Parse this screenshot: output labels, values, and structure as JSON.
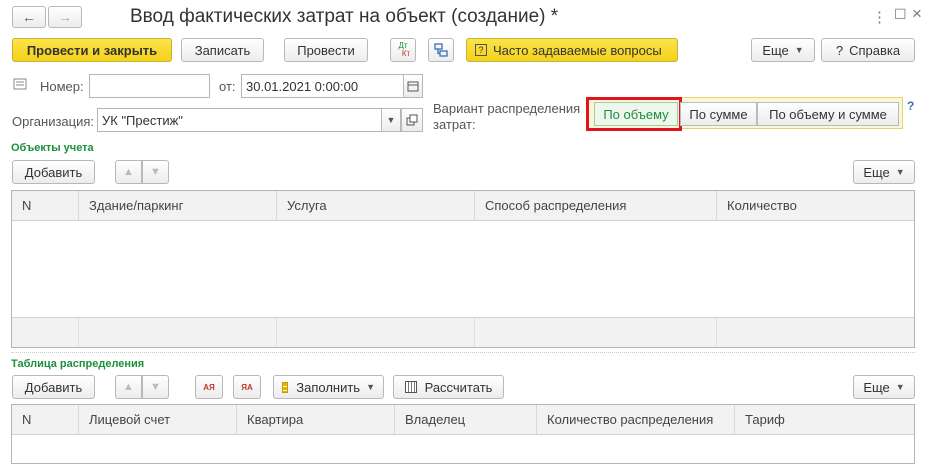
{
  "window": {
    "title": "Ввод фактических затрат на объект (создание) *",
    "back_icon": "←",
    "forward_icon": "→",
    "menu_icon": "⋮",
    "maximize_icon": "☐",
    "close_icon": "×"
  },
  "toolbar": {
    "post_close_label": "Провести и закрыть",
    "save_label": "Записать",
    "post_label": "Провести",
    "dt_kt_top": "Дт",
    "dt_kt_bottom": "Кт",
    "faq_label": "Часто задаваемые вопросы",
    "more_label": "Еще",
    "help_label": "Справка",
    "help_icon": "?"
  },
  "form": {
    "number_label": "Номер:",
    "number_value": "",
    "date_label": "от:",
    "date_value": "30.01.2021  0:00:00",
    "org_label": "Организация:",
    "org_value": "УК \"Престиж\"",
    "variant_label_1": "Вариант распределения",
    "variant_label_2": "затрат:",
    "variant_options": [
      "По объему",
      "По сумме",
      "По объему и сумме"
    ],
    "variant_selected": "По объему",
    "variant_help": "?",
    "highlight_color": "#e0141e"
  },
  "objects": {
    "section_title": "Объекты учета",
    "add_label": "Добавить",
    "more_label": "Еще",
    "columns": [
      "N",
      "Здание/паркинг",
      "Услуга",
      "Способ распределения",
      "Количество"
    ]
  },
  "distribution": {
    "section_title": "Таблица распределения",
    "add_label": "Добавить",
    "fill_label": "Заполнить",
    "calc_label": "Рассчитать",
    "more_label": "Еще",
    "sort_az": "АЯ",
    "sort_za": "ЯА",
    "columns": [
      "N",
      "Лицевой счет",
      "Квартира",
      "Владелец",
      "Количество распределения",
      "Тариф"
    ]
  },
  "colors": {
    "accent_yellow": "#f6d62e",
    "section_green": "#1c8f3a",
    "selected_green": "#1c8f3a"
  }
}
